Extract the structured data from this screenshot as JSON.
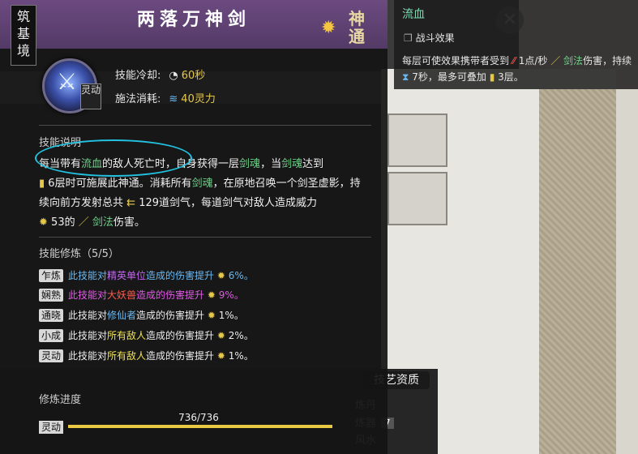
{
  "header": {
    "realm": "筑基境",
    "title": "两落万神剑",
    "badge": "神通"
  },
  "skill": {
    "type_tag": "灵动",
    "cooldown_label": "技能冷却:",
    "cooldown_value": "60秒",
    "cost_label": "施法消耗:",
    "cost_value": "40灵力"
  },
  "description": {
    "label": "技能说明",
    "p1": "每当带有",
    "p2": "流血",
    "p3": "的敌人死亡时，自身获得一层",
    "p4": "剑魂",
    "p5": "，当",
    "p6": "剑魂",
    "p7": "达到",
    "p8": "6层时可施展此神通。消耗所有",
    "p9": "剑魂",
    "p10": "，在原地召唤一个剑圣虚影，持续向前方发射总共",
    "p11": "129道剑气，每道剑气对敌人造成威力",
    "p12": "53的",
    "p13": "剑法",
    "p14": "伤害。"
  },
  "mastery": {
    "label": "技能修炼（5/5）",
    "rows": [
      {
        "tag": "乍炼",
        "a": "此技能对",
        "b": "精英单位",
        "c": "造成的伤害提升",
        "d": "6%。"
      },
      {
        "tag": "娴熟",
        "a": "此技能对",
        "b": "大妖兽",
        "c": "造成的伤害提升",
        "d": "9%。"
      },
      {
        "tag": "通晓",
        "a": "此技能对",
        "b": "修仙者",
        "c": "造成的伤害提升",
        "d": "1%。"
      },
      {
        "tag": "小成",
        "a": "此技能对",
        "b": "所有敌人",
        "c": "造成的伤害提升",
        "d": "2%。"
      },
      {
        "tag": "灵动",
        "a": "此技能对",
        "b": "所有敌人",
        "c": "造成的伤害提升",
        "d": "1%。"
      }
    ]
  },
  "progress": {
    "label": "修炼进度",
    "tag": "灵动",
    "text": "736/736",
    "fraction": 1.0
  },
  "side": {
    "title": "流血",
    "subtitle": "战斗效果",
    "d1": "每层可使效果携带者受到",
    "d2": "1点/秒",
    "d3": "剑法",
    "d4": "伤害，持续",
    "d5": "7秒，最多可叠加",
    "d6": "3层。"
  },
  "background": {
    "close": "✕",
    "skill_title": "技艺资质",
    "skill_rows": [
      {
        "label": "炼丹",
        "value": ""
      },
      {
        "label": "炼器",
        "value": "7"
      },
      {
        "label": "风水",
        "value": ""
      }
    ]
  },
  "colors": {
    "header": "#5e4272",
    "accent_green": "#6fd08a",
    "accent_gold": "#e5c84a",
    "highlight": "#22c2e0"
  },
  "icons": {
    "cooldown": "clock-icon",
    "mana": "mana-icon",
    "sword_soul": "scroll-icon",
    "sword_qi": "arrows-icon",
    "power": "star-icon",
    "sword": "sword-icon",
    "bleed": "bleed-icon",
    "hourglass": "hourglass-icon"
  }
}
